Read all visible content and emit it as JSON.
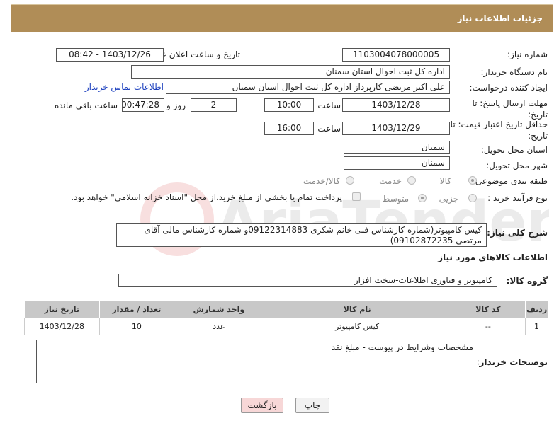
{
  "header": {
    "title": "جزئیات اطلاعات نیاز"
  },
  "fields": {
    "need_number_label": "شماره نیاز:",
    "need_number": "1103004078000005",
    "announce_label": "تاریخ و ساعت اعلان عمومی:",
    "announce_value": "1403/12/26 - 08:42",
    "buyer_org_label": "نام دستگاه خریدار:",
    "buyer_org": "اداره کل ثبت احوال استان سمنان",
    "creator_label": "ایجاد کننده درخواست:",
    "creator": "علی اکبر  مرتضی کارپرداز اداره کل ثبت احوال استان سمنان",
    "contact_link": "اطلاعات تماس خریدار",
    "deadline_label": "مهلت ارسال پاسخ: تا تاریخ:",
    "deadline_date": "1403/12/28",
    "time_label": "ساعت",
    "deadline_time": "10:00",
    "days_value": "2",
    "days_label": "روز و",
    "remaining_time": "00:47:28",
    "remaining_label": "ساعت باقی مانده",
    "validity_label": "حداقل تاریخ اعتبار قیمت: تا تاریخ:",
    "validity_date": "1403/12/29",
    "validity_time": "16:00",
    "province_label": "استان محل تحویل:",
    "province": "سمنان",
    "city_label": "شهر محل تحویل:",
    "city": "سمنان",
    "category_label": "طبقه بندی موضوعی:",
    "cat_goods": "کالا",
    "cat_service": "خدمت",
    "cat_goods_service": "کالا/خدمت",
    "process_label": "نوع فرآیند خرید :",
    "proc_partial": "جزیی",
    "proc_medium": "متوسط",
    "payment_note": "پرداخت تمام یا بخشی از مبلغ خرید،از محل \"اسناد خزانه اسلامی\" خواهد بود."
  },
  "description": {
    "label": "شرح کلی نیاز:",
    "text": "کیس کامپیوتر(شماره کارشناس فنی خانم شکری 09122314883و شماره کارشناس مالی آقای مرتضی 09102872235)"
  },
  "goods_section": {
    "title": "اطلاعات کالاهای مورد نیاز",
    "group_label": "گروه کالا:",
    "group_value": "کامپیوتر و فناوری اطلاعات-سخت افزار"
  },
  "table": {
    "headers": [
      "ردیف",
      "کد کالا",
      "نام کالا",
      "واحد شمارش",
      "تعداد / مقدار",
      "تاریخ نیاز"
    ],
    "rows": [
      [
        "1",
        "--",
        "کیس کامپیوتر",
        "عدد",
        "10",
        "1403/12/28"
      ]
    ]
  },
  "buyer_notes": {
    "label": "توضیحات خریدار:",
    "text": "مشخصات  وشرایط در پیوست - مبلغ نقد"
  },
  "buttons": {
    "print": "چاپ",
    "back": "بازگشت"
  },
  "watermark": {
    "text": "AriaTender.neT"
  },
  "colors": {
    "header": "#b08d57",
    "link": "#1b3fbe",
    "back_bg": "#f7d7d7"
  }
}
